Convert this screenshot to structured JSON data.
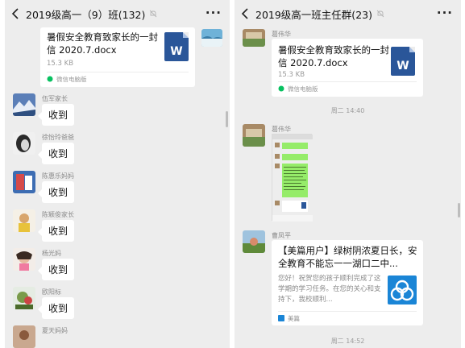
{
  "left": {
    "header": {
      "title": "2019级高一（9）班(132)",
      "more_icon": "more-dots-icon",
      "mute_icon": "mute-bell-icon"
    },
    "file": {
      "name": "暑假安全教育致家长的一封信 2020.7.docx",
      "size": "15.3 KB",
      "source": "微信电脑版",
      "type_letter": "W"
    },
    "messages": [
      {
        "nick": "伍军家长",
        "text": "收到"
      },
      {
        "nick": "徐怡玲爸爸",
        "text": "收到"
      },
      {
        "nick": "陈惠乐妈妈",
        "text": "收到"
      },
      {
        "nick": "陈颖俊家长",
        "text": "收到"
      },
      {
        "nick": "杨光妈",
        "text": "收到"
      },
      {
        "nick": "欧阳标",
        "text": "收到"
      },
      {
        "nick": "夏天妈妈",
        "text": ""
      }
    ]
  },
  "right": {
    "header": {
      "title": "2019级高一班主任群(23)",
      "more_icon": "more-dots-icon",
      "mute_icon": "mute-bell-icon"
    },
    "msg1": {
      "nick": "葛伟华",
      "file_name": "暑假安全教育致家长的一封信 2020.7.docx",
      "file_size": "15.3 KB",
      "source": "微信电脑版",
      "type_letter": "W"
    },
    "time1": "周二 14:40",
    "msg2": {
      "nick": "葛伟华"
    },
    "msg3": {
      "nick": "曹凤平",
      "title": "【美篇用户】绿树阴浓夏日长，安全教育不能忘一一湖口二中...",
      "desc": "您好！祝贺您的孩子顺利完成了这学期的学习任务。在您的关心和支持下，我校顺利...",
      "source": "美篇"
    },
    "time2": "周二 14:52"
  },
  "colors": {
    "bg": "#ededed",
    "bubble": "#ffffff",
    "word_blue": "#2a5699",
    "meipian_blue": "#1a85d6",
    "wechat_green": "#07c160"
  }
}
